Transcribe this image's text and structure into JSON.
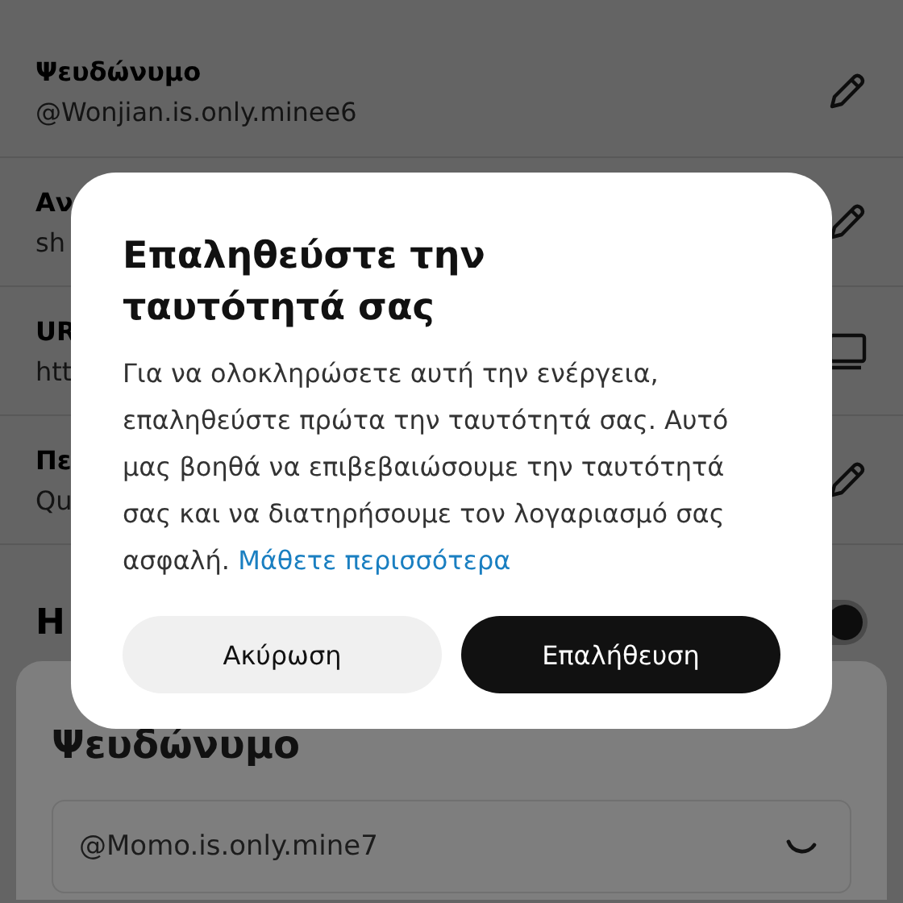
{
  "profile_rows": [
    {
      "label": "Ψευδώνυμο",
      "value": "@Wonjian.is.only.minee6"
    },
    {
      "label": "Αν",
      "value": "sh"
    },
    {
      "label": "UR",
      "value": "htt"
    },
    {
      "label": "Πε",
      "value": "Qu"
    }
  ],
  "toggle_row": {
    "label": "Η",
    "on": true
  },
  "sheet": {
    "title": "Ψευδώνυμο",
    "field_value": "@Momo.is.only.mine7",
    "loading": true
  },
  "dialog": {
    "title": "Επαληθεύστε την ταυτότητά σας",
    "body": "Για να ολοκληρώσετε αυτή την ενέργεια, επαληθεύστε πρώτα την ταυτότητά σας. Αυτό μας βοηθά να επιβεβαιώσουμε την ταυτότητά σας και να διατηρήσουμε τον λογαριασμό σας ασφαλή.",
    "link": "Μάθετε περισσότερα",
    "buttons": [
      {
        "label": "Ακύρωση",
        "kind": "secondary"
      },
      {
        "label": "Επαλήθευση",
        "kind": "primary"
      }
    ]
  }
}
